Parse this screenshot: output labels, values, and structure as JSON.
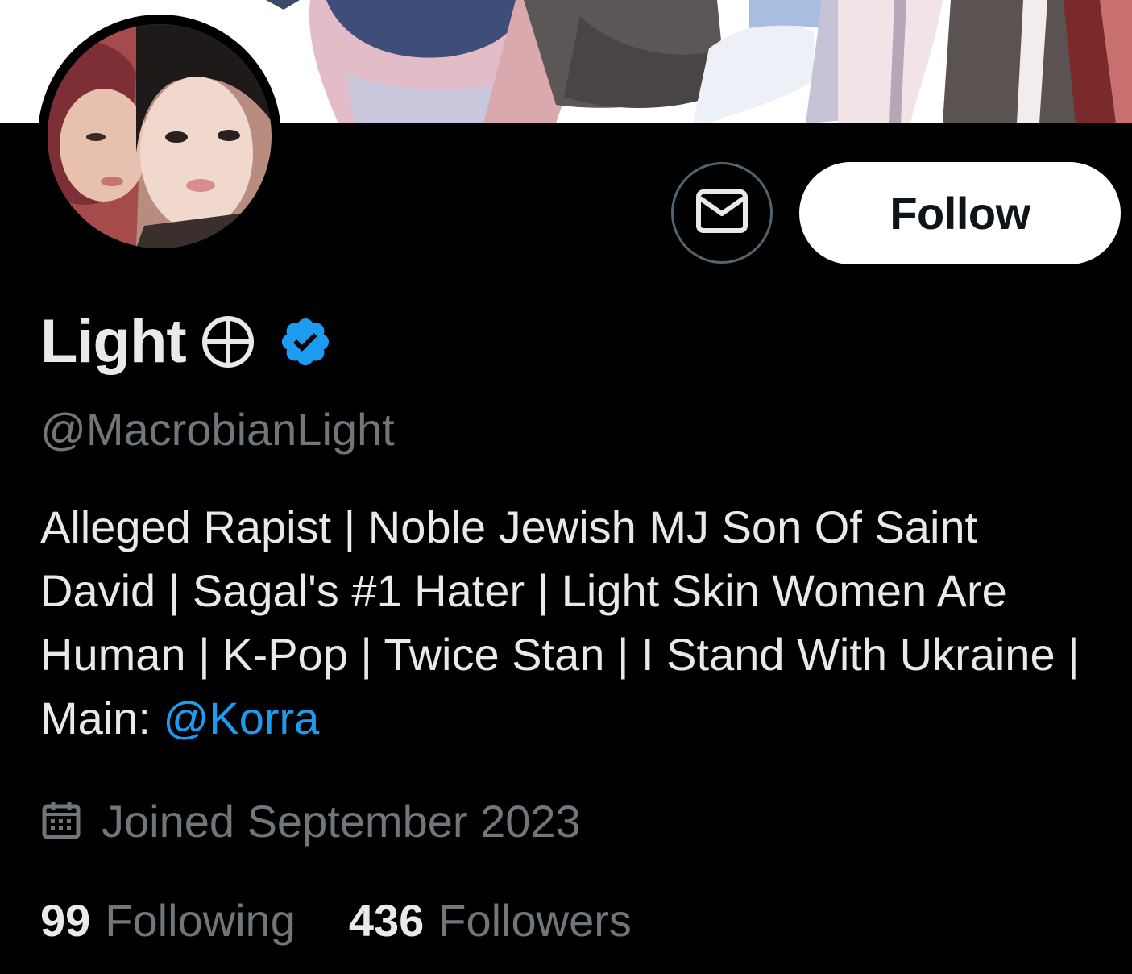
{
  "profile": {
    "display_name": "Light",
    "name_symbol": "⊕",
    "handle": "@MacrobianLight",
    "bio_text": "Alleged Rapist | Noble Jewish MJ Son Of Saint David | Sagal's #1 Hater | Light Skin Women Are Human | K-Pop | Twice Stan | I Stand With Ukraine | Main: ",
    "bio_mention": "@Korra",
    "joined": "Joined September 2023",
    "following_count": "99",
    "following_label": "Following",
    "followers_count": "436",
    "followers_label": "Followers"
  },
  "actions": {
    "follow_label": "Follow",
    "message_icon": "envelope-icon"
  },
  "icons": {
    "verified": "verified-badge-icon",
    "calendar": "calendar-icon"
  },
  "colors": {
    "background": "#000000",
    "text_primary": "#e7e9ea",
    "text_secondary": "#71767b",
    "accent": "#1d9bf0",
    "follow_bg": "#ffffff",
    "border": "#536471"
  }
}
